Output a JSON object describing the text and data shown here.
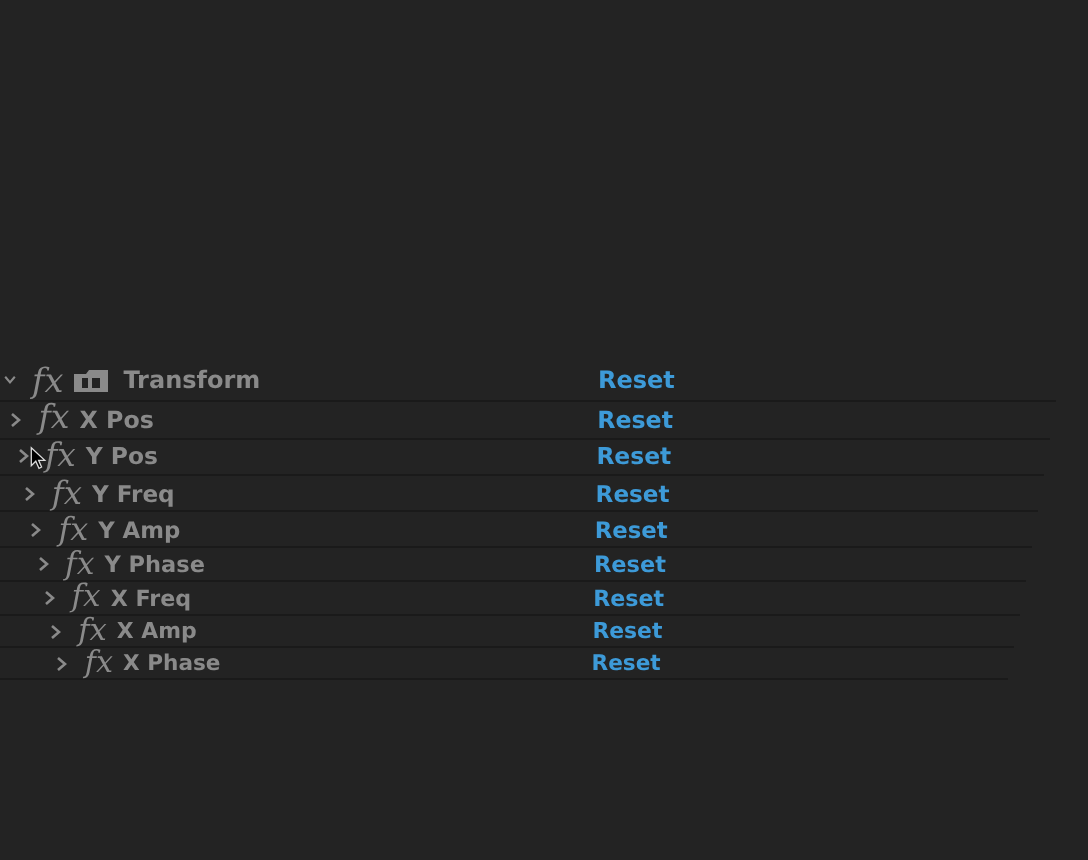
{
  "effects": [
    {
      "fx": "fx",
      "name": "Transform",
      "expanded": true,
      "has_preset_icon": true,
      "reset": "Reset"
    },
    {
      "fx": "fx",
      "name": "X Pos",
      "expanded": false,
      "has_preset_icon": false,
      "reset": "Reset"
    },
    {
      "fx": "fx",
      "name": "Y Pos",
      "expanded": false,
      "has_preset_icon": false,
      "reset": "Reset"
    },
    {
      "fx": "fx",
      "name": "Y Freq",
      "expanded": false,
      "has_preset_icon": false,
      "reset": "Reset"
    },
    {
      "fx": "fx",
      "name": "Y Amp",
      "expanded": false,
      "has_preset_icon": false,
      "reset": "Reset"
    },
    {
      "fx": "fx",
      "name": "Y Phase",
      "expanded": false,
      "has_preset_icon": false,
      "reset": "Reset"
    },
    {
      "fx": "fx",
      "name": "X Freq",
      "expanded": false,
      "has_preset_icon": false,
      "reset": "Reset"
    },
    {
      "fx": "fx",
      "name": "X Amp",
      "expanded": false,
      "has_preset_icon": false,
      "reset": "Reset"
    },
    {
      "fx": "fx",
      "name": "X Phase",
      "expanded": false,
      "has_preset_icon": false,
      "reset": "Reset"
    }
  ]
}
